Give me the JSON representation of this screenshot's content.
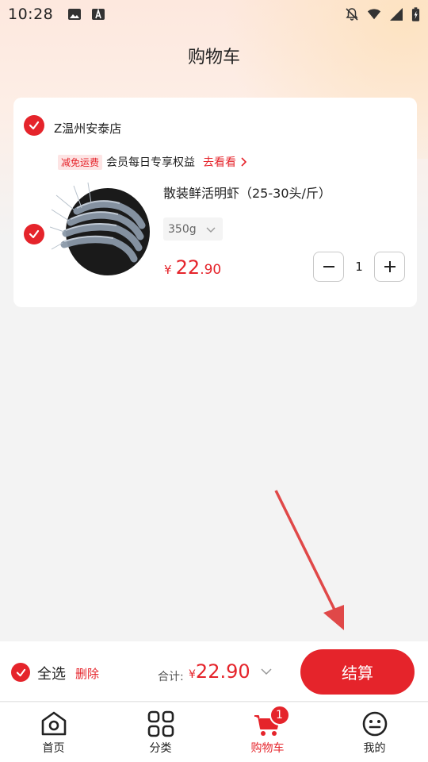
{
  "status_bar": {
    "time": "10:28",
    "icons": [
      "image-icon",
      "font-icon",
      "bell-off-icon",
      "wifi-icon",
      "signal-icon",
      "battery-icon"
    ]
  },
  "header": {
    "title": "购物车"
  },
  "store": {
    "name": "Z温州安泰店",
    "checked": true
  },
  "promo": {
    "badge": "减免运费",
    "text": "会员每日专享权益",
    "link": "去看看"
  },
  "item": {
    "title": "散装鲜活明虾（25-30头/斤）",
    "spec": "350g",
    "price_currency": "¥",
    "price_int": "22",
    "price_dec": ".90",
    "quantity": "1",
    "checked": true,
    "image_icon": "shrimp-image"
  },
  "checkout": {
    "select_all_label": "全选",
    "delete_label": "删除",
    "total_label": "合计:",
    "total_currency": "¥",
    "total_value": "22.90",
    "button_label": "结算"
  },
  "tabs": [
    {
      "label": "首页",
      "icon": "home-icon"
    },
    {
      "label": "分类",
      "icon": "category-icon"
    },
    {
      "label": "购物车",
      "icon": "cart-icon",
      "badge": "1",
      "active": true
    },
    {
      "label": "我的",
      "icon": "profile-icon"
    }
  ],
  "colors": {
    "accent": "#e5242b",
    "background": "#f3f3f3"
  }
}
